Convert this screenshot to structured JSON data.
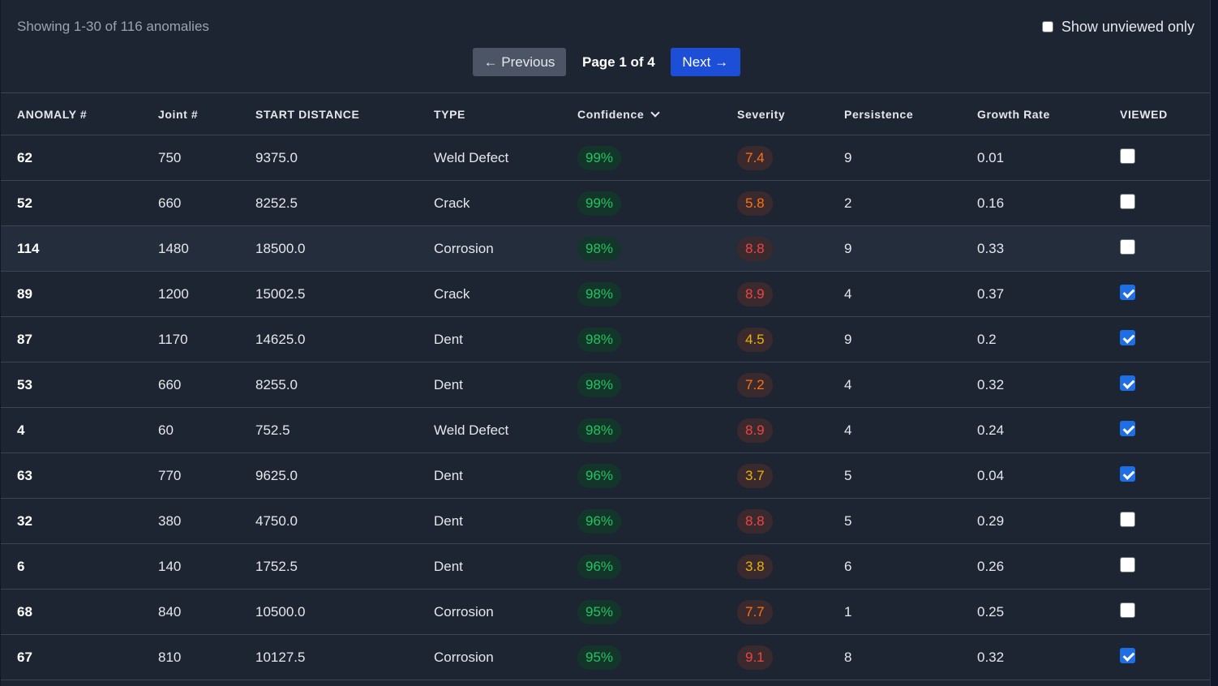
{
  "summary": "Showing 1-30 of 116 anomalies",
  "filter": {
    "label": "Show unviewed only",
    "checked": false
  },
  "pagination": {
    "prev_label": "← Previous",
    "page_info": "Page 1 of 4",
    "next_label": "Next →"
  },
  "columns": [
    "ANOMALY #",
    "Joint #",
    "START DISTANCE",
    "TYPE",
    "Confidence",
    "Severity",
    "Persistence",
    "Growth Rate",
    "VIEWED"
  ],
  "sort": {
    "column": "Confidence",
    "direction": "descending",
    "icon": "chevron-down-icon"
  },
  "colors": {
    "confidence": "#22c55e",
    "severity_high": "#ef4444",
    "severity_mid": "#f97316",
    "severity_low": "#eab308",
    "accent": "#1d4ed8"
  },
  "rows": [
    {
      "id": "62",
      "joint": "750",
      "start": "9375.0",
      "type": "Weld Defect",
      "confidence": "99%",
      "severity": "7.4",
      "severity_color": "#f97316",
      "persistence": "9",
      "growth": "0.01",
      "viewed": false
    },
    {
      "id": "52",
      "joint": "660",
      "start": "8252.5",
      "type": "Crack",
      "confidence": "99%",
      "severity": "5.8",
      "severity_color": "#f97316",
      "persistence": "2",
      "growth": "0.16",
      "viewed": false
    },
    {
      "id": "114",
      "joint": "1480",
      "start": "18500.0",
      "type": "Corrosion",
      "confidence": "98%",
      "severity": "8.8",
      "severity_color": "#ef4444",
      "persistence": "9",
      "growth": "0.33",
      "viewed": false
    },
    {
      "id": "89",
      "joint": "1200",
      "start": "15002.5",
      "type": "Crack",
      "confidence": "98%",
      "severity": "8.9",
      "severity_color": "#ef4444",
      "persistence": "4",
      "growth": "0.37",
      "viewed": true
    },
    {
      "id": "87",
      "joint": "1170",
      "start": "14625.0",
      "type": "Dent",
      "confidence": "98%",
      "severity": "4.5",
      "severity_color": "#eab308",
      "persistence": "9",
      "growth": "0.2",
      "viewed": true
    },
    {
      "id": "53",
      "joint": "660",
      "start": "8255.0",
      "type": "Dent",
      "confidence": "98%",
      "severity": "7.2",
      "severity_color": "#f97316",
      "persistence": "4",
      "growth": "0.32",
      "viewed": true
    },
    {
      "id": "4",
      "joint": "60",
      "start": "752.5",
      "type": "Weld Defect",
      "confidence": "98%",
      "severity": "8.9",
      "severity_color": "#ef4444",
      "persistence": "4",
      "growth": "0.24",
      "viewed": true
    },
    {
      "id": "63",
      "joint": "770",
      "start": "9625.0",
      "type": "Dent",
      "confidence": "96%",
      "severity": "3.7",
      "severity_color": "#eab308",
      "persistence": "5",
      "growth": "0.04",
      "viewed": true
    },
    {
      "id": "32",
      "joint": "380",
      "start": "4750.0",
      "type": "Dent",
      "confidence": "96%",
      "severity": "8.8",
      "severity_color": "#ef4444",
      "persistence": "5",
      "growth": "0.29",
      "viewed": false
    },
    {
      "id": "6",
      "joint": "140",
      "start": "1752.5",
      "type": "Dent",
      "confidence": "96%",
      "severity": "3.8",
      "severity_color": "#eab308",
      "persistence": "6",
      "growth": "0.26",
      "viewed": false
    },
    {
      "id": "68",
      "joint": "840",
      "start": "10500.0",
      "type": "Corrosion",
      "confidence": "95%",
      "severity": "7.7",
      "severity_color": "#f97316",
      "persistence": "1",
      "growth": "0.25",
      "viewed": false
    },
    {
      "id": "67",
      "joint": "810",
      "start": "10127.5",
      "type": "Corrosion",
      "confidence": "95%",
      "severity": "9.1",
      "severity_color": "#ef4444",
      "persistence": "8",
      "growth": "0.32",
      "viewed": true
    }
  ]
}
